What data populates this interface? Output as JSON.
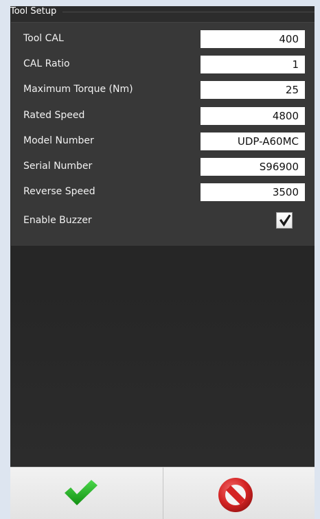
{
  "panel": {
    "title": "Tool Setup"
  },
  "fields": [
    {
      "label": "Tool CAL",
      "value": "400"
    },
    {
      "label": "CAL Ratio",
      "value": "1"
    },
    {
      "label": "Maximum Torque (Nm)",
      "value": "25"
    },
    {
      "label": "Rated Speed",
      "value": "4800"
    },
    {
      "label": "Model Number",
      "value": "UDP-A60MC"
    },
    {
      "label": "Serial Number",
      "value": "S96900"
    },
    {
      "label": "Reverse Speed",
      "value": "3500"
    }
  ],
  "buzzer": {
    "label": "Enable Buzzer",
    "checked": true
  },
  "footer": {
    "ok_icon": "checkmark-icon",
    "cancel_icon": "cancel-icon"
  },
  "colors": {
    "panel_bg": "#2c2c2c",
    "group_bg": "#383838",
    "ok_green": "#1ea51e",
    "cancel_red": "#d42424"
  }
}
